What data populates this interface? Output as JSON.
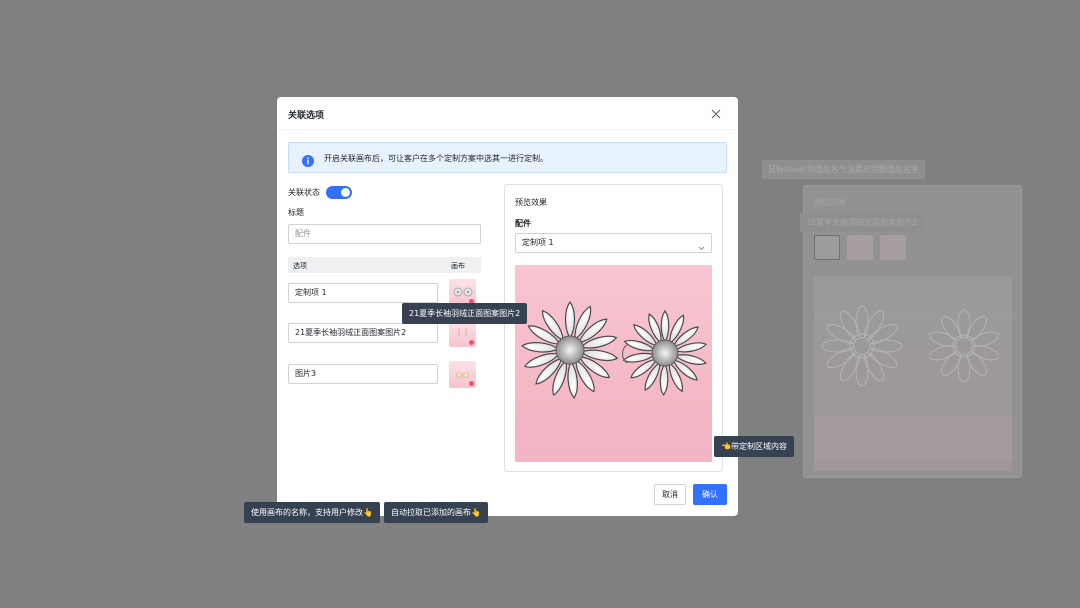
{
  "background_panel": {
    "tip": "鼠标hover到图层名气泡提示完整图层名字",
    "title": "预览效果",
    "tooltip": "21夏季长袖羽绒正面图案图片2",
    "label": "配件"
  },
  "modal": {
    "title": "关联选项",
    "info": "开启关联画布后，可让客户在多个定制方案中选其一进行定制。",
    "status_label": "关联状态",
    "toggle_on": true,
    "title_label": "标题",
    "title_placeholder": "配件",
    "table_headers": {
      "option": "选项",
      "canvas": "画布"
    },
    "options": [
      {
        "name": "定制项 1"
      },
      {
        "name": "21夏季长袖羽绒正面图案图片2"
      },
      {
        "name": "图片3"
      }
    ],
    "preview": {
      "title": "预览效果",
      "field_label": "配件",
      "selected": "定制项 1"
    },
    "buttons": {
      "cancel": "取消",
      "confirm": "确认"
    }
  },
  "annotations": {
    "thumb_tooltip": "21夏季长袖羽绒正面图案图片2",
    "custom_area": "👈带定制区域内容",
    "name_hint": "使用画布的名称，支持用户修改👆",
    "auto_hint": "自动拉取已添加的画布👆"
  },
  "colors": {
    "primary": "#3370ff",
    "overlay": "#808080",
    "tooltip_bg": "#364152"
  }
}
